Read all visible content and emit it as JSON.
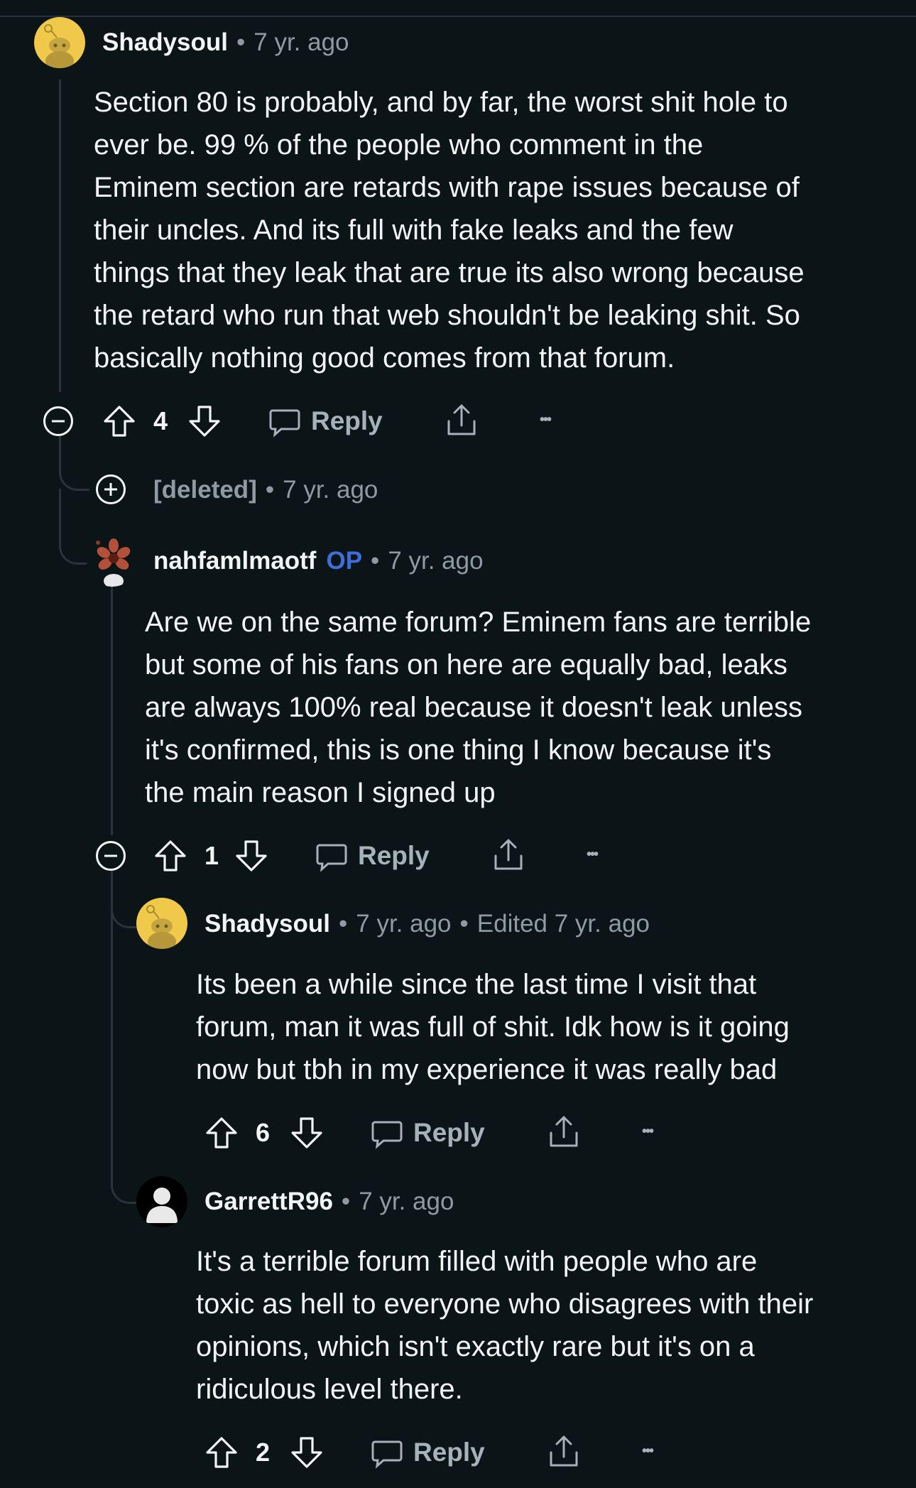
{
  "comments": [
    {
      "author": "Shadysoul",
      "time": "7 yr. ago",
      "body": "Section 80 is probably, and by far, the worst shit hole to\never be. 99 % of the people who comment in the\nEminem section are retards with rape issues because of\ntheir uncles. And its full with fake leaks and the few\nthings that they leak that are true its also wrong because\nthe retard who run that web shouldn't be leaking shit. So\nbasically nothing good comes from that forum.",
      "votes": "4",
      "reply_label": "Reply"
    },
    {
      "author": "[deleted]",
      "time": "7 yr. ago"
    },
    {
      "author": "nahfamlmaotf",
      "op_badge": "OP",
      "time": "7 yr. ago",
      "body": "Are we on the same forum? Eminem fans are terrible\nbut some of his fans on here are equally bad, leaks\nare always 100% real because it doesn't leak unless\nit's confirmed, this is one thing I know because it's\nthe main reason I signed up",
      "votes": "1",
      "reply_label": "Reply"
    },
    {
      "author": "Shadysoul",
      "time": "7 yr. ago",
      "edited": "Edited 7 yr. ago",
      "body": "Its been a while since the last time I visit that\nforum, man it was full of shit. Idk how is it going\nnow but tbh in my experience it was really bad",
      "votes": "6",
      "reply_label": "Reply"
    },
    {
      "author": "GarrettR96",
      "time": "7 yr. ago",
      "body": "It's a terrible forum filled with people who are\ntoxic as hell to everyone who disagrees with their\nopinions, which isn't exactly rare but it's on a\nridiculous level there.",
      "votes": "2",
      "reply_label": "Reply"
    }
  ],
  "separator": "•",
  "more_label": "•••",
  "colors": {
    "background": "#0b1416",
    "text": "#f2f4f5",
    "muted": "#8e9ba2",
    "op_badge": "#3e6fd8",
    "thread_line": "#2a3338"
  },
  "icons": [
    "snoo-avatar-icon",
    "upvote-arrow-icon",
    "downvote-arrow-icon",
    "comment-bubble-icon",
    "share-icon",
    "more-options-icon",
    "collapse-minus-icon",
    "expand-plus-icon",
    "demogorgon-avatar-icon",
    "default-user-avatar-icon"
  ]
}
